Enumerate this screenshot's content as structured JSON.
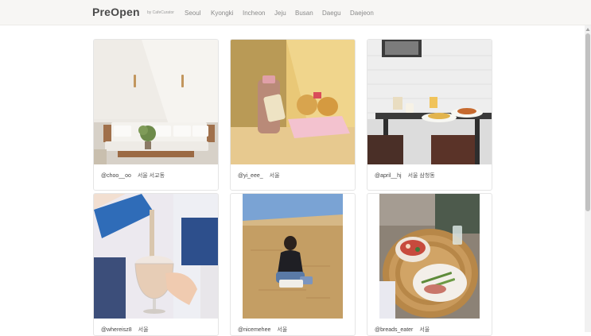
{
  "nav": {
    "brand": "PreOpen",
    "byline": "by CafeCurator",
    "links": [
      "Seoul",
      "Kyongki",
      "Incheon",
      "Jeju",
      "Busan",
      "Daegu",
      "Daejeon"
    ]
  },
  "cards": [
    {
      "user": "@choo__oo",
      "location": "서울 서교동"
    },
    {
      "user": "@yi_eee_",
      "location": "서울"
    },
    {
      "user": "@april__hj",
      "location": "서울 삼청동"
    },
    {
      "user": "@whereisz8",
      "location": "서울"
    },
    {
      "user": "@nicemehee",
      "location": "서울"
    },
    {
      "user": "@breads_eater",
      "location": "서울"
    }
  ],
  "colors": {
    "nav_bg": "#f7f6f4",
    "brand": "#4a4a4a",
    "link": "#8a8a8a"
  }
}
